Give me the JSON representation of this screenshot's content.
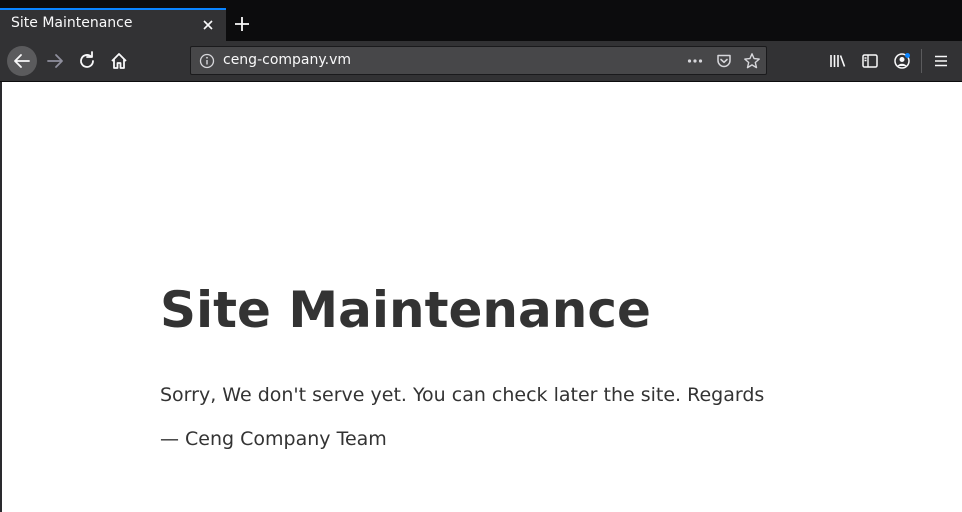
{
  "browser": {
    "tab": {
      "title": "Site Maintenance",
      "accent_color": "#0a84ff"
    },
    "toolbar": {
      "back_icon": "arrow-left-icon",
      "forward_icon": "arrow-right-icon",
      "reload_icon": "reload-icon",
      "home_icon": "home-icon",
      "library_icon": "library-icon",
      "sidebar_icon": "sidebar-icon",
      "account_icon": "account-icon",
      "menu_icon": "hamburger-menu-icon"
    },
    "urlbar": {
      "url": "ceng-company.vm",
      "info_icon": "info-icon",
      "actions": [
        "more-actions-icon",
        "pocket-icon",
        "bookmark-star-icon"
      ]
    }
  },
  "page": {
    "title": "Site Maintenance",
    "message": "Sorry, We don't serve yet. You can check later the site. Regards",
    "signature": "— Ceng Company Team",
    "text_color": "#333333"
  }
}
